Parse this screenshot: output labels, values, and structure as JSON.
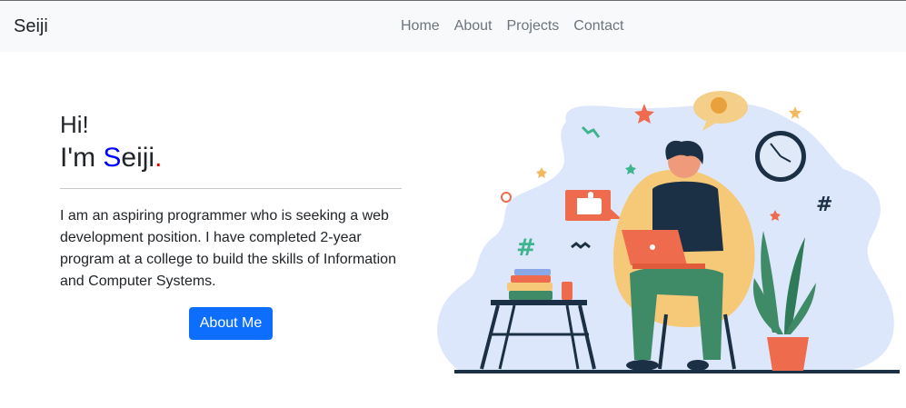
{
  "navbar": {
    "brand": "Seiji",
    "links": [
      "Home",
      "About",
      "Projects",
      "Contact"
    ]
  },
  "hero": {
    "greeting": "Hi!",
    "intro_prefix": "I'm ",
    "name_first_letter": "S",
    "name_rest": "eiji",
    "name_dot": ".",
    "bio": "I am an aspiring programmer who is seeking a web development position. I have completed 2-year program at a college to build the skills of Information and Computer Systems.",
    "button_label": "About Me"
  },
  "colors": {
    "accent_blue": "#0d6efd",
    "name_letter": "#0000ff",
    "dot_red": "#ff0000",
    "navbar_bg": "#f8f9fa",
    "illustration_blob": "#dde7fb"
  },
  "icons": [
    "working-person-illustration",
    "wall-clock-icon",
    "thumbs-up-icon",
    "chat-bubble-icon",
    "hashtag-icon",
    "star-icon",
    "plant-icon"
  ]
}
